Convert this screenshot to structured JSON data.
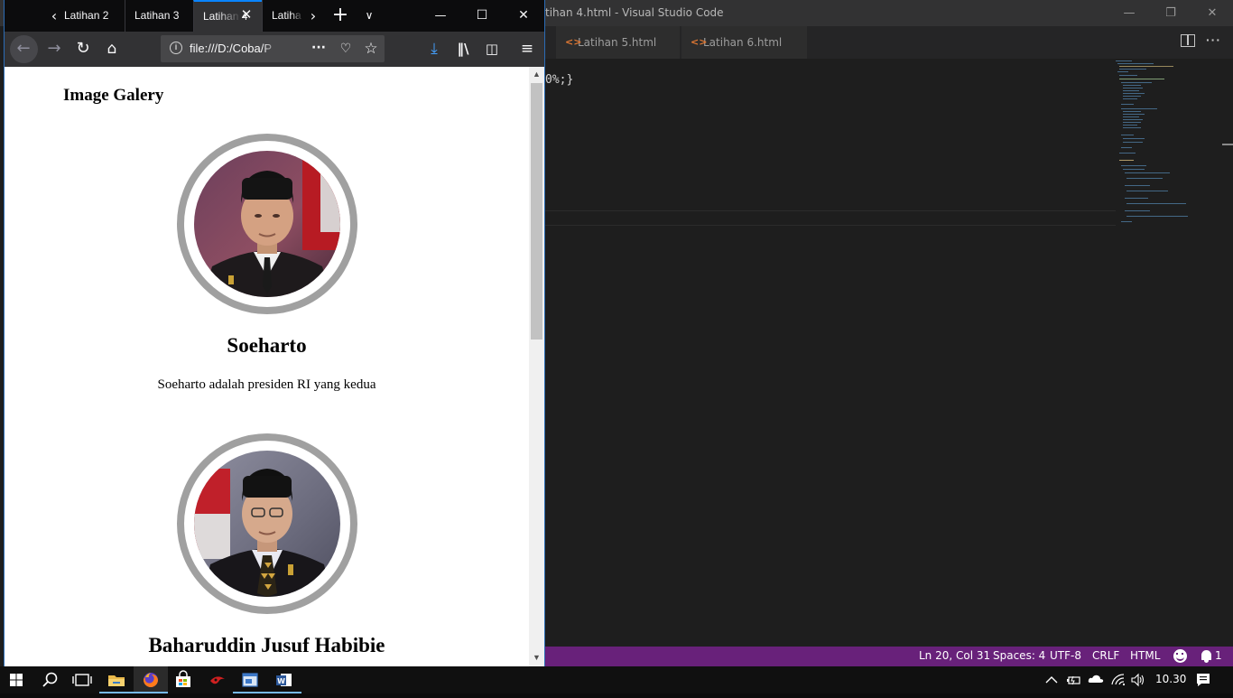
{
  "vscode": {
    "title": "tihan 4.html - Visual Studio Code",
    "tabs": [
      {
        "label": "Latihan 5.html"
      },
      {
        "label": "Latihan 6.html"
      }
    ],
    "code_line": "0%;}",
    "statusbar": {
      "position": "Ln 20, Col 31",
      "spaces": "Spaces: 4",
      "encoding": "UTF-8",
      "eol": "CRLF",
      "language": "HTML",
      "notifications": "1"
    },
    "accent_color": "#68217a"
  },
  "firefox": {
    "tabs": [
      {
        "label": "Latihan 2"
      },
      {
        "label": "Latihan 3"
      },
      {
        "label": "Latihan 4"
      },
      {
        "label": "Latiha"
      }
    ],
    "url": "file:///D:/Coba/P",
    "accent_color": "#0a84ff"
  },
  "page": {
    "heading": "Image Galery",
    "cards": [
      {
        "name": "Soeharto",
        "description": "Soeharto adalah presiden RI yang kedua"
      },
      {
        "name": "Baharuddin Jusuf Habibie"
      }
    ]
  },
  "taskbar": {
    "clock": "10.30",
    "pinned_icons": [
      "windows-start-icon",
      "search-icon",
      "task-view-icon",
      "file-explorer-icon",
      "firefox-icon",
      "store-icon",
      "app-icon",
      "app-window-icon",
      "word-icon"
    ]
  }
}
